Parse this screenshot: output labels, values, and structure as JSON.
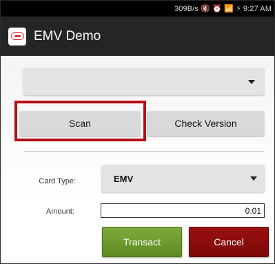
{
  "status_bar": {
    "text": "309B/s 🔇 ⏰ 📶 ⚡ 9:27 AM"
  },
  "app": {
    "title": "EMV Demo",
    "icon": "acs-logo-icon"
  },
  "top_spinner": {
    "value": "",
    "icon": "caret-down-icon"
  },
  "buttons": {
    "scan": "Scan",
    "check_version": "Check Version",
    "transact": "Transact",
    "cancel": "Cancel"
  },
  "form": {
    "card_type_label": "Card Type:",
    "card_type_value": "EMV",
    "amount_label": "Amount:",
    "amount_value": "0.01"
  },
  "colors": {
    "highlight": "#b50d14",
    "transact": "#6b9a2e",
    "cancel": "#8b0b0b",
    "action_bar": "#252525"
  }
}
